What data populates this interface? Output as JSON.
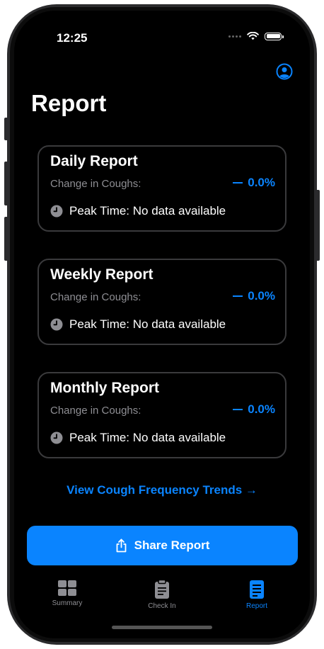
{
  "status_bar": {
    "time": "12:25"
  },
  "page": {
    "title": "Report"
  },
  "reports": [
    {
      "title": "Daily Report",
      "change_label": "Change in Coughs:",
      "change_value": "0.0%",
      "peak_text": "Peak Time: No data available"
    },
    {
      "title": "Weekly Report",
      "change_label": "Change in Coughs:",
      "change_value": "0.0%",
      "peak_text": "Peak Time: No data available"
    },
    {
      "title": "Monthly Report",
      "change_label": "Change in Coughs:",
      "change_value": "0.0%",
      "peak_text": "Peak Time: No data available"
    }
  ],
  "trends_link": "View Cough Frequency Trends →",
  "share_button": {
    "label": "Share Report",
    "icon": "share-icon"
  },
  "tab_bar": {
    "items": [
      {
        "label": "Summary",
        "icon": "grid-icon",
        "active": false
      },
      {
        "label": "Check In",
        "icon": "clipboard-icon",
        "active": false
      },
      {
        "label": "Report",
        "icon": "document-icon",
        "active": true
      }
    ]
  },
  "colors": {
    "accent": "#0a84ff",
    "background": "#000000",
    "card_border": "#3a3a3c",
    "secondary_text": "#8e8e93",
    "inactive_tab": "#8e8e93"
  }
}
